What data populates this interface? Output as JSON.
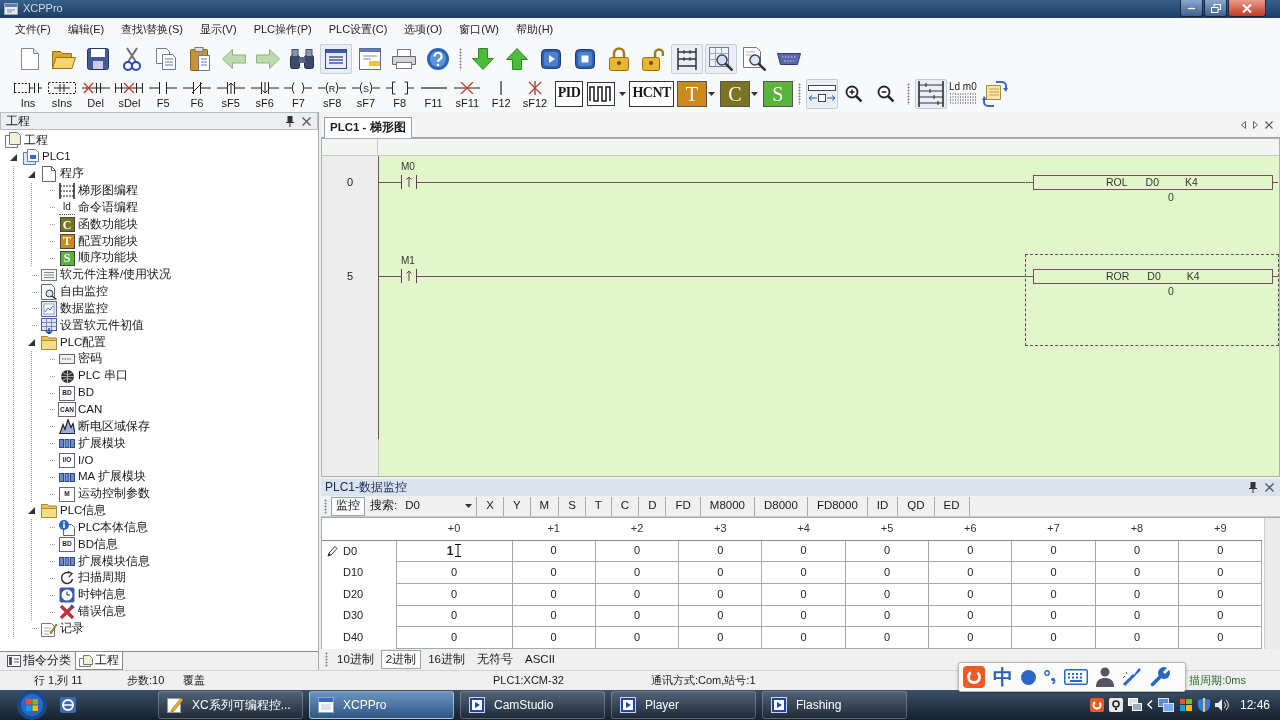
{
  "window": {
    "title": "XCPPro"
  },
  "menu": [
    "文件(F)",
    "编辑(E)",
    "查找\\替换(S)",
    "显示(V)",
    "PLC操作(P)",
    "PLC设置(C)",
    "选项(O)",
    "窗口(W)",
    "帮助(H)"
  ],
  "toolbar": [
    [
      {
        "pressed": false
      },
      {
        "pressed": false
      },
      {
        "pressed": false
      },
      {
        "pressed": false
      },
      {
        "pressed": false
      },
      {
        "pressed": false
      },
      {
        "pressed": false
      },
      {
        "pressed": false
      },
      {
        "pressed": false
      },
      {
        "pressed": true
      },
      {
        "pressed": false
      },
      {
        "pressed": false
      },
      {
        "pressed": false
      }
    ],
    [
      {
        "pressed": false
      },
      {
        "pressed": false
      },
      {
        "pressed": false
      },
      {
        "pressed": false
      },
      {
        "pressed": false
      },
      {
        "pressed": false
      },
      {
        "pressed": true
      },
      {
        "pressed": true
      },
      {
        "pressed": false
      },
      {
        "pressed": false
      }
    ]
  ],
  "ladder_tools": [
    {
      "label": "Ins",
      "kind": "insert-row"
    },
    {
      "label": "sIns",
      "kind": "insert-line"
    },
    {
      "label": "Del",
      "kind": "delete-row"
    },
    {
      "label": "sDel",
      "kind": "delete-line"
    },
    {
      "label": "F5",
      "kind": "contact-no"
    },
    {
      "label": "F6",
      "kind": "contact-nc"
    },
    {
      "label": "sF5",
      "kind": "rising"
    },
    {
      "label": "sF6",
      "kind": "falling"
    },
    {
      "label": "F7",
      "kind": "coil"
    },
    {
      "label": "sF8",
      "kind": "coil",
      "symbol": "R"
    },
    {
      "label": "sF7",
      "kind": "coil",
      "symbol": "S"
    },
    {
      "label": "F8",
      "kind": "instruction"
    },
    {
      "label": "F11",
      "kind": "hline"
    },
    {
      "label": "sF11",
      "kind": "hline-delete"
    },
    {
      "label": "F12",
      "kind": "vline"
    },
    {
      "label": "sF12",
      "kind": "vline-delete"
    }
  ],
  "block_tools": [
    {
      "kind": "text",
      "text": "PID",
      "dropdown": false
    },
    {
      "kind": "pulse",
      "dropdown": true
    },
    {
      "kind": "text",
      "text": "HCNT",
      "dropdown": false
    },
    {
      "kind": "tile",
      "text": "T",
      "color": "#cc8a1e",
      "dropdown": true
    },
    {
      "kind": "tile",
      "text": "C",
      "color": "#7a7422",
      "dropdown": true
    },
    {
      "kind": "tile",
      "text": "S",
      "color": "#5ab33a",
      "dropdown": false
    }
  ],
  "view_tools": [
    [
      {
        "kind": "move",
        "pressed": true
      },
      {
        "kind": "zoom-in",
        "pressed": false
      },
      {
        "kind": "zoom-out",
        "pressed": false
      }
    ],
    [
      {
        "kind": "ladder",
        "pressed": true
      },
      {
        "kind": "text",
        "text": "Ld m0",
        "pressed": false
      },
      {
        "kind": "refresh",
        "pressed": false
      }
    ]
  ],
  "project_panel": {
    "title": "工程",
    "tree": [
      {
        "label": "工程",
        "kind": "project",
        "children": [
          {
            "label": "PLC1",
            "kind": "plc",
            "expanded": true,
            "children": [
              {
                "label": "程序",
                "kind": "program",
                "expanded": true,
                "children": [
                  {
                    "label": "梯形图编程",
                    "kind": "ladder"
                  },
                  {
                    "label": "命令语编程",
                    "kind": "instruction-list",
                    "icon_text": "ld"
                  },
                  {
                    "label": "函数功能块",
                    "kind": "tile",
                    "icon_text": "C",
                    "color": "#7a7422"
                  },
                  {
                    "label": "配置功能块",
                    "kind": "tile",
                    "icon_text": "T",
                    "color": "#cc8a1e"
                  },
                  {
                    "label": "顺序功能块",
                    "kind": "tile",
                    "icon_text": "S",
                    "color": "#5ab33a"
                  }
                ]
              },
              {
                "label": "软元件注释/使用状况",
                "kind": "comment"
              },
              {
                "label": "自由监控",
                "kind": "free-monitor"
              },
              {
                "label": "数据监控",
                "kind": "data-monitor"
              },
              {
                "label": "设置软元件初值",
                "kind": "initial-value"
              },
              {
                "label": "PLC配置",
                "kind": "folder",
                "expanded": true,
                "children": [
                  {
                    "label": "密码",
                    "kind": "password"
                  },
                  {
                    "label": "PLC 串口",
                    "kind": "serial-port"
                  },
                  {
                    "label": "BD",
                    "kind": "boxed",
                    "icon_text": "BD"
                  },
                  {
                    "label": "CAN",
                    "kind": "boxed",
                    "icon_text": "CAN"
                  },
                  {
                    "label": "断电区域保存",
                    "kind": "power-save"
                  },
                  {
                    "label": "扩展模块",
                    "kind": "module"
                  },
                  {
                    "label": "I/O",
                    "kind": "boxed",
                    "icon_text": "I/O"
                  },
                  {
                    "label": "MA 扩展模块",
                    "kind": "module"
                  },
                  {
                    "label": "运动控制参数",
                    "kind": "boxed",
                    "icon_text": "M"
                  }
                ]
              },
              {
                "label": "PLC信息",
                "kind": "folder",
                "expanded": true,
                "children": [
                  {
                    "label": "PLC本体信息",
                    "kind": "info"
                  },
                  {
                    "label": "BD信息",
                    "kind": "boxed",
                    "icon_text": "BD"
                  },
                  {
                    "label": "扩展模块信息",
                    "kind": "module"
                  },
                  {
                    "label": "扫描周期",
                    "kind": "cycle"
                  },
                  {
                    "label": "时钟信息",
                    "kind": "clock"
                  },
                  {
                    "label": "错误信息",
                    "kind": "error"
                  }
                ]
              },
              {
                "label": "记录",
                "kind": "log"
              }
            ]
          }
        ]
      }
    ],
    "tabs": [
      {
        "label": "指令分类",
        "selected": false
      },
      {
        "label": "工程",
        "selected": true
      }
    ]
  },
  "editor": {
    "tabs": [
      {
        "label": "PLC1 - 梯形图",
        "selected": true
      }
    ],
    "rungs": [
      {
        "step": "0",
        "contact": {
          "label": "M0",
          "kind": "rising"
        },
        "instruction": [
          "ROL",
          "D0",
          "K4"
        ],
        "value": "0",
        "selected": false
      },
      {
        "step": "5",
        "contact": {
          "label": "M1",
          "kind": "rising"
        },
        "instruction": [
          "ROR",
          "D0",
          "K4"
        ],
        "value": "0",
        "selected": true
      }
    ]
  },
  "monitor": {
    "title": "PLC1-数据监控",
    "mode_button": {
      "label": "监控",
      "pressed": true
    },
    "search_label": "搜索:",
    "search_value": "D0",
    "filters": [
      "X",
      "Y",
      "M",
      "S",
      "T",
      "C",
      "D",
      "FD",
      "M8000",
      "D8000",
      "FD8000",
      "ID",
      "QD",
      "ED"
    ],
    "columns": [
      "+0",
      "+1",
      "+2",
      "+3",
      "+4",
      "+5",
      "+6",
      "+7",
      "+8",
      "+9"
    ],
    "rows": [
      {
        "label": "D0",
        "editing": true,
        "values": [
          "1",
          "0",
          "0",
          "0",
          "0",
          "0",
          "0",
          "0",
          "0",
          "0"
        ]
      },
      {
        "label": "D10",
        "editing": false,
        "values": [
          "0",
          "0",
          "0",
          "0",
          "0",
          "0",
          "0",
          "0",
          "0",
          "0"
        ]
      },
      {
        "label": "D20",
        "editing": false,
        "values": [
          "0",
          "0",
          "0",
          "0",
          "0",
          "0",
          "0",
          "0",
          "0",
          "0"
        ]
      },
      {
        "label": "D30",
        "editing": false,
        "values": [
          "0",
          "0",
          "0",
          "0",
          "0",
          "0",
          "0",
          "0",
          "0",
          "0"
        ]
      },
      {
        "label": "D40",
        "editing": false,
        "values": [
          "0",
          "0",
          "0",
          "0",
          "0",
          "0",
          "0",
          "0",
          "0",
          "0"
        ]
      }
    ],
    "tabs": [
      {
        "label": "10进制",
        "selected": false
      },
      {
        "label": "2进制",
        "selected": true
      },
      {
        "label": "16进制",
        "selected": false
      },
      {
        "label": "无符号",
        "selected": false
      },
      {
        "label": "ASCII",
        "selected": false
      }
    ]
  },
  "status_bar": [
    "行 1,列 11",
    "步数:10",
    "覆盖",
    "PLC1:XCM-32",
    "通讯方式:Com,站号:1",
    "描周期:0ms"
  ],
  "ime_bar": {
    "mode": "中"
  },
  "taskbar": {
    "tasks": [
      {
        "label": "XC系列可编程控...",
        "selected": false
      },
      {
        "label": "XCPPro",
        "selected": true
      },
      {
        "label": "CamStudio",
        "selected": false
      },
      {
        "label": "Player",
        "selected": false
      },
      {
        "label": "Flashing",
        "selected": false
      }
    ],
    "clock": "12:46"
  }
}
